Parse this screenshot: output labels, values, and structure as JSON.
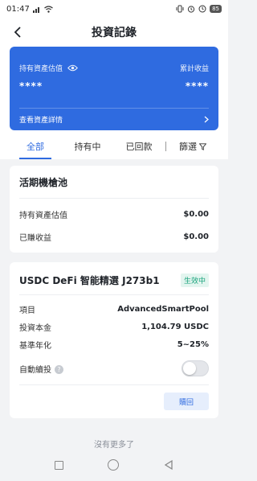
{
  "status_bar": {
    "time": "01:47",
    "battery": "85",
    "icons": [
      "signal-icon",
      "wifi-icon",
      "vibrate-icon",
      "alarm-icon",
      "battery-icon"
    ]
  },
  "nav": {
    "title": "投資記錄",
    "back_icon": "back-arrow-icon"
  },
  "summary": {
    "holding_label": "持有資產估值",
    "holding_value": "****",
    "cumulative_label": "累計收益",
    "cumulative_value": "****",
    "details_link": "查看資產詳情",
    "card_color": "#2f6be0"
  },
  "tabs": {
    "items": [
      "全部",
      "持有中",
      "已回款"
    ],
    "active": "全部",
    "filter_label": "篩選"
  },
  "pool_card": {
    "title": "活期機槍池",
    "rows": [
      {
        "label": "持有資產估值",
        "value": "$0.00"
      },
      {
        "label": "已賺收益",
        "value": "$0.00"
      }
    ]
  },
  "product_card": {
    "title": "USDC DeFi 智能精選 J273b1",
    "status": "生效中",
    "rows": [
      {
        "label": "項目",
        "value": "AdvancedSmartPool"
      },
      {
        "label": "投資本金",
        "value": "1,104.79 USDC"
      },
      {
        "label": "基準年化",
        "value": "5~25%"
      }
    ],
    "auto_reinvest_label": "自動續投",
    "auto_reinvest_on": false,
    "redeem_label": "贖回",
    "status_color": "#19a37c"
  },
  "footer": {
    "no_more": "沒有更多了"
  }
}
